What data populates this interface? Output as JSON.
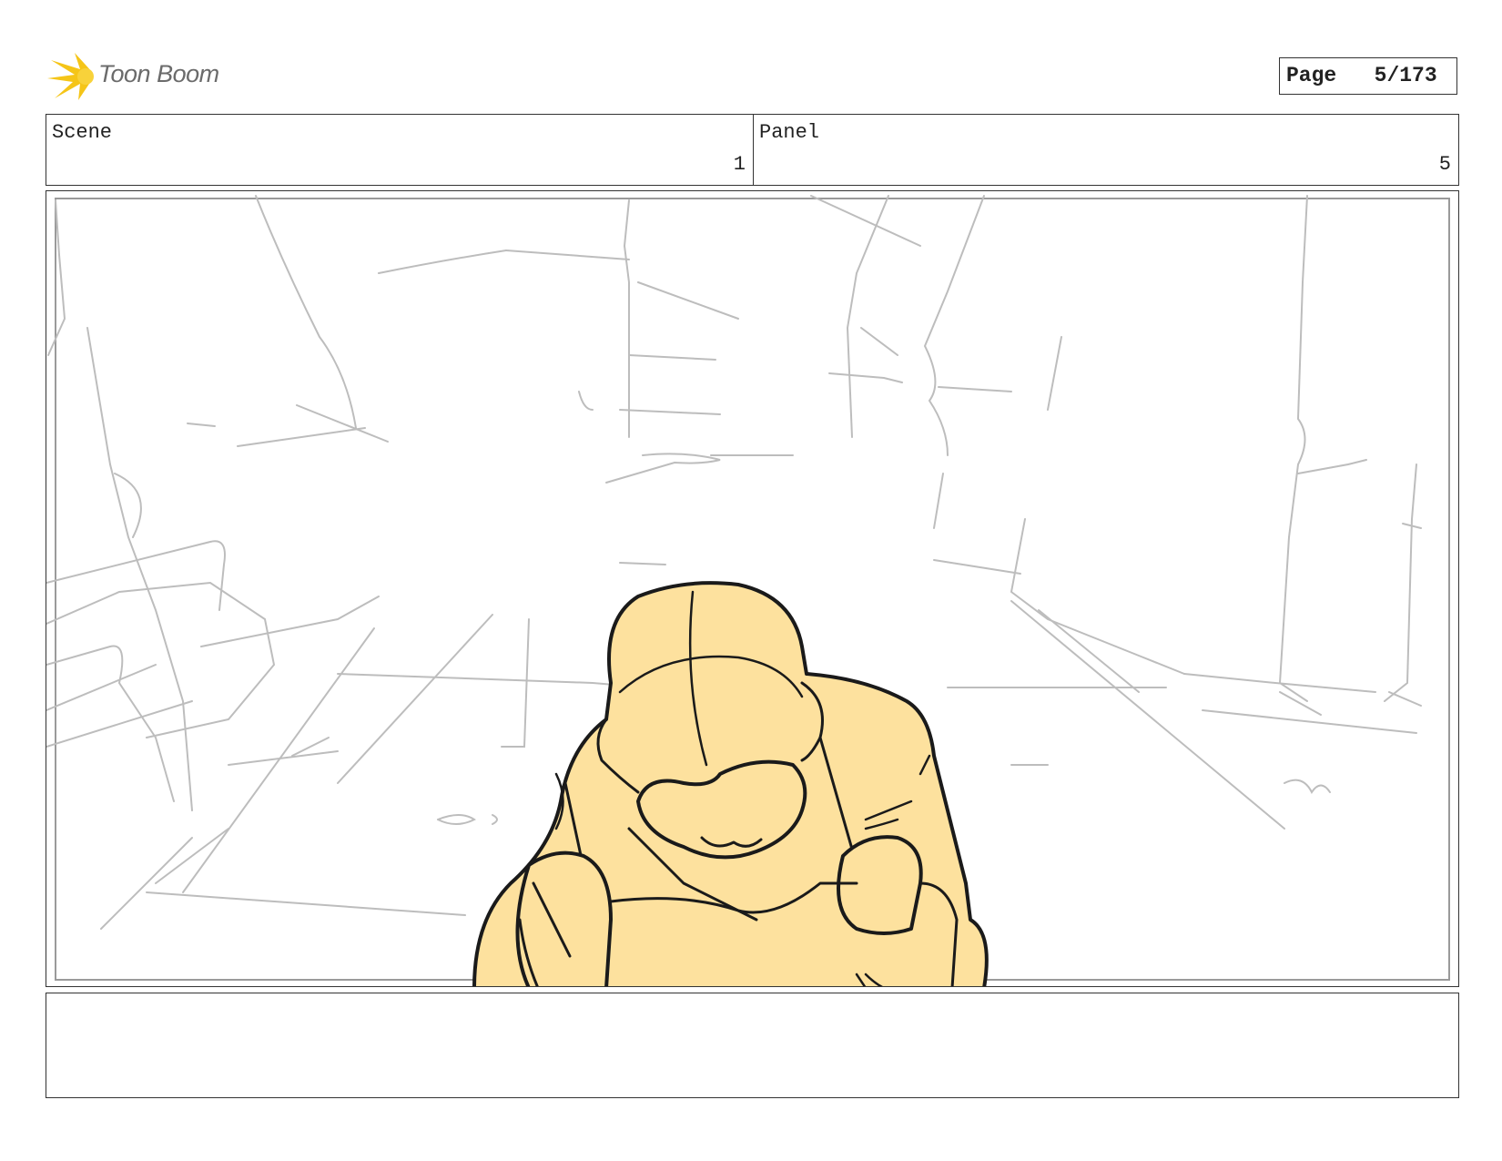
{
  "brand": {
    "name": "Toon Boom",
    "accent": "#f5c518",
    "text_color": "#6b6b6b"
  },
  "page": {
    "label": "Page",
    "value": "5/173"
  },
  "scene": {
    "label": "Scene",
    "value": "1"
  },
  "panel": {
    "label": "Panel",
    "value": "5"
  },
  "colors": {
    "sketch_line": "#bdbdbd",
    "character_fill": "#fde19e",
    "ink": "#1a1a1a"
  },
  "notes": {
    "text": ""
  }
}
